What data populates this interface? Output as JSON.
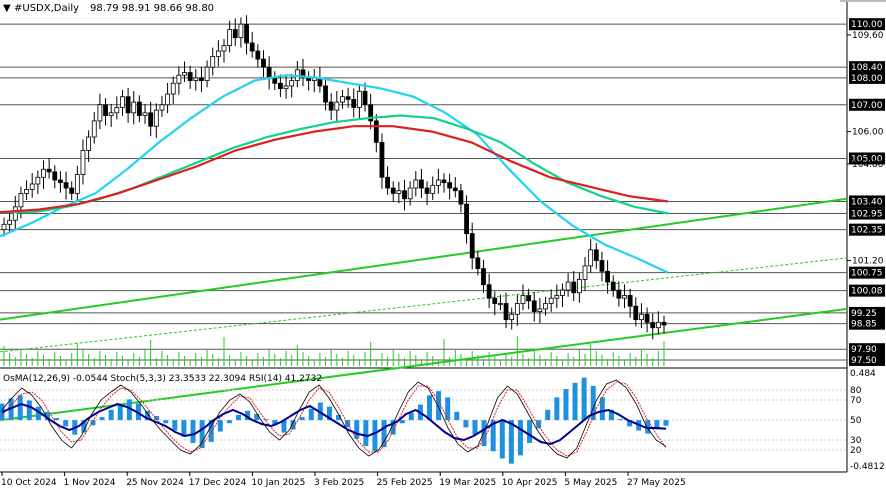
{
  "header": {
    "symbol": "#USDX,Daily",
    "ohlc": "98.79 98.91 98.66 98.80",
    "arrow": "▼"
  },
  "indicator_header": "OsMA(12,26,9) -0.0544  Stoch(5,3,3) 23.3533 22.3094  RSI(14) 41.2732",
  "colors": {
    "background": "#ffffff",
    "candles": "#000000",
    "ma_fast": "#22d3ee",
    "ma_mid": "#10d38a",
    "ma_slow": "#dc2020",
    "channel": "#22cc22",
    "grid": "#cccccc",
    "level_line": "#555555",
    "price_tag_bg": "#000000",
    "osma": "#1e90e0",
    "rsi": "#00008b",
    "stoch_main": "#000000",
    "stoch_signal": "#dd2222"
  },
  "chart_data": [
    {
      "type": "candlestick",
      "title": "#USDX,Daily",
      "x_labels": [
        "10 Oct 2024",
        "1 Nov 2024",
        "25 Nov 2024",
        "17 Dec 2024",
        "10 Jan 2025",
        "3 Feb 2025",
        "25 Feb 2025",
        "19 Mar 2025",
        "10 Apr 2025",
        "5 May 2025",
        "27 May 2025"
      ],
      "ylim": [
        97.2,
        110.9
      ],
      "y_tick_labels": [
        "109.60",
        "106.00",
        "104.80",
        "101.20"
      ],
      "level_labels": [
        "110.00",
        "108.40",
        "108.00",
        "107.00",
        "105.00",
        "103.40",
        "102.95",
        "102.35",
        "100.75",
        "100.08",
        "99.25",
        "98.85",
        "97.90",
        "97.50"
      ],
      "last_price": 98.8,
      "series": [
        {
          "name": "Close",
          "values": [
            102.55,
            102.7,
            103.2,
            103.7,
            103.85,
            104.05,
            104.3,
            104.6,
            104.5,
            104.2,
            104.1,
            103.9,
            103.7,
            104.4,
            105.3,
            105.8,
            106.4,
            107.0,
            106.6,
            106.7,
            106.9,
            107.3,
            106.7,
            107.1,
            106.6,
            106.7,
            106.2,
            106.8,
            107.0,
            107.4,
            107.8,
            108.1,
            108.2,
            107.9,
            108.0,
            107.9,
            108.4,
            108.8,
            109.0,
            109.2,
            109.8,
            109.5,
            110.0,
            109.3,
            109.0,
            108.7,
            108.4,
            108.0,
            107.8,
            107.6,
            107.7,
            107.9,
            108.3,
            108.0,
            107.9,
            108.0,
            107.7,
            107.1,
            106.8,
            107.1,
            107.3,
            107.2,
            106.9,
            107.5,
            107.0,
            106.4,
            105.6,
            104.3,
            103.9,
            103.7,
            103.8,
            103.5,
            103.9,
            104.2,
            103.9,
            103.7,
            104.0,
            104.2,
            104.1,
            103.9,
            103.8,
            103.3,
            102.2,
            101.3,
            100.9,
            100.3,
            99.8,
            99.6,
            99.6,
            99.0,
            99.2,
            99.6,
            99.9,
            99.7,
            99.3,
            99.4,
            99.6,
            99.8,
            99.9,
            100.1,
            100.4,
            100.0,
            100.5,
            101.0,
            101.6,
            101.2,
            100.8,
            100.4,
            100.1,
            99.8,
            99.9,
            99.5,
            99.0,
            99.2,
            98.9,
            98.7,
            98.9,
            98.8
          ]
        },
        {
          "name": "MA fast",
          "values": [
            102.1,
            102.6,
            103.2,
            103.7,
            104.6,
            105.6,
            106.5,
            107.3,
            107.9,
            108.1,
            108.0,
            107.8,
            107.6,
            107.3,
            106.7,
            105.9,
            104.6,
            103.4,
            102.5,
            101.8,
            101.3,
            100.75
          ]
        },
        {
          "name": "MA mid",
          "values": [
            103.0,
            103.0,
            103.2,
            103.5,
            103.9,
            104.4,
            104.9,
            105.4,
            105.8,
            106.1,
            106.35,
            106.5,
            106.6,
            106.5,
            106.1,
            105.6,
            104.8,
            104.1,
            103.6,
            103.2,
            102.95
          ]
        },
        {
          "name": "MA slow",
          "values": [
            103.0,
            103.1,
            103.3,
            103.7,
            104.2,
            104.7,
            105.3,
            105.7,
            106.0,
            106.2,
            106.2,
            106.0,
            105.6,
            104.9,
            104.3,
            103.95,
            103.6,
            103.4
          ]
        },
        {
          "name": "Channel upper",
          "values": [
            99.0,
            103.5
          ]
        },
        {
          "name": "Channel lower",
          "values": [
            97.3,
            99.4
          ]
        },
        {
          "name": "Channel middle",
          "values": [
            97.8,
            101.3
          ]
        }
      ]
    },
    {
      "type": "bar",
      "title": "OsMA(12,26,9) Stoch(5,3,3) RSI(14)",
      "ylim": [
        -0.4812,
        0.484
      ],
      "y_tick_labels": [
        "0.484",
        "80",
        "70",
        "50",
        "30",
        "20",
        "-0.4812"
      ],
      "series": [
        {
          "name": "OsMA",
          "values": [
            0.16,
            0.21,
            0.24,
            0.19,
            0.13,
            0.08,
            0.02,
            -0.06,
            -0.14,
            -0.12,
            -0.05,
            0.03,
            0.1,
            0.15,
            0.2,
            0.16,
            0.09,
            0.04,
            -0.03,
            -0.1,
            -0.16,
            -0.22,
            -0.27,
            -0.21,
            -0.11,
            -0.03,
            0.05,
            0.09,
            0.06,
            0.01,
            -0.05,
            -0.12,
            -0.09,
            0.03,
            0.11,
            0.17,
            0.13,
            0.05,
            -0.07,
            -0.18,
            -0.25,
            -0.3,
            -0.26,
            -0.14,
            -0.03,
            0.07,
            0.15,
            0.24,
            0.28,
            0.22,
            0.08,
            -0.07,
            -0.14,
            -0.25,
            -0.3,
            -0.37,
            -0.42,
            -0.34,
            -0.22,
            -0.08,
            0.1,
            0.22,
            0.3,
            0.36,
            0.41,
            0.33,
            0.22,
            0.1,
            0.01,
            -0.06,
            -0.1,
            -0.13,
            -0.09,
            -0.054
          ]
        },
        {
          "name": "Stoch main",
          "values": [
            60,
            72,
            82,
            75,
            62,
            44,
            30,
            22,
            34,
            55,
            70,
            78,
            85,
            78,
            66,
            52,
            40,
            30,
            20,
            16,
            25,
            42,
            58,
            70,
            76,
            68,
            52,
            38,
            30,
            40,
            60,
            78,
            85,
            72,
            55,
            36,
            22,
            14,
            20,
            36,
            58,
            78,
            88,
            82,
            64,
            42,
            26,
            18,
            24,
            46,
            72,
            84,
            76,
            58,
            40,
            26,
            16,
            12,
            22,
            46,
            70,
            86,
            90,
            82,
            66,
            44,
            30,
            23.3533
          ]
        },
        {
          "name": "Stoch signal",
          "values": [
            55,
            66,
            76,
            78,
            70,
            54,
            38,
            28,
            30,
            46,
            62,
            74,
            82,
            80,
            70,
            58,
            46,
            34,
            24,
            18,
            22,
            36,
            52,
            64,
            74,
            72,
            58,
            44,
            34,
            36,
            52,
            70,
            82,
            78,
            62,
            44,
            28,
            18,
            18,
            30,
            50,
            70,
            84,
            84,
            70,
            50,
            32,
            22,
            22,
            38,
            62,
            80,
            80,
            64,
            46,
            32,
            20,
            14,
            18,
            38,
            62,
            80,
            88,
            86,
            72,
            52,
            36,
            22.3094
          ]
        },
        {
          "name": "RSI",
          "values": [
            58,
            62,
            66,
            63,
            57,
            50,
            44,
            40,
            44,
            52,
            58,
            62,
            66,
            63,
            58,
            52,
            48,
            44,
            38,
            34,
            36,
            42,
            50,
            56,
            60,
            56,
            50,
            46,
            44,
            48,
            54,
            60,
            64,
            58,
            52,
            46,
            40,
            36,
            34,
            38,
            44,
            48,
            56,
            60,
            54,
            46,
            38,
            32,
            30,
            34,
            40,
            46,
            50,
            46,
            40,
            34,
            28,
            26,
            30,
            38,
            46,
            54,
            58,
            60,
            56,
            50,
            46,
            42,
            42,
            41.2732
          ]
        }
      ]
    }
  ]
}
